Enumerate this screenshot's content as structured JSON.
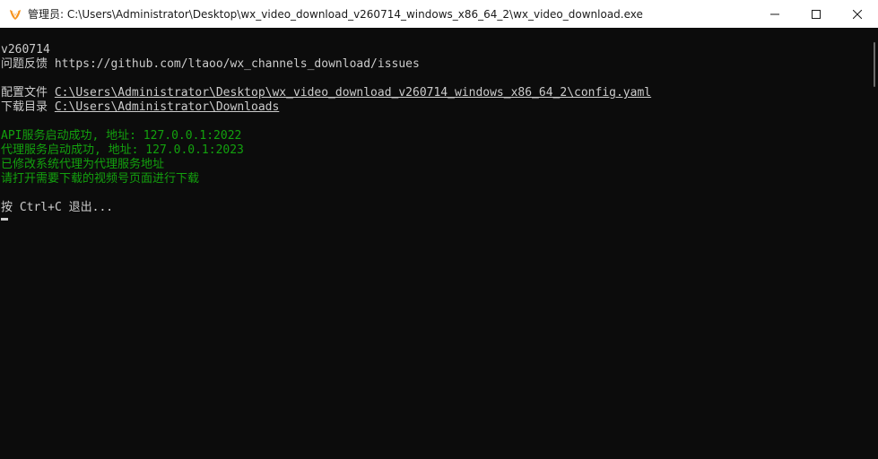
{
  "window": {
    "title": "管理员: C:\\Users\\Administrator\\Desktop\\wx_video_download_v260714_windows_x86_64_2\\wx_video_download.exe",
    "controls": {
      "minimize_icon": "minimize-icon",
      "maximize_icon": "maximize-icon",
      "close_icon": "close-icon"
    }
  },
  "console": {
    "version": "v260714",
    "issues_label": "问题反馈",
    "issues_url": "https://github.com/ltaoo/wx_channels_download/issues",
    "config_label": "配置文件",
    "config_path": "C:\\Users\\Administrator\\Desktop\\wx_video_download_v260714_windows_x86_64_2\\config.yaml",
    "download_label": "下载目录",
    "download_path": "C:\\Users\\Administrator\\Downloads",
    "api_status": "API服务启动成功, 地址: 127.0.0.1:2022",
    "proxy_status": "代理服务启动成功, 地址: 127.0.0.1:2023",
    "system_proxy_status": "已修改系统代理为代理服务地址",
    "instruction": "请打开需要下载的视频号页面进行下载",
    "exit_hint": "按 Ctrl+C 退出..."
  },
  "colors": {
    "background": "#0c0c0c",
    "text": "#cccccc",
    "success": "#13a10e",
    "titlebar": "#ffffff"
  }
}
